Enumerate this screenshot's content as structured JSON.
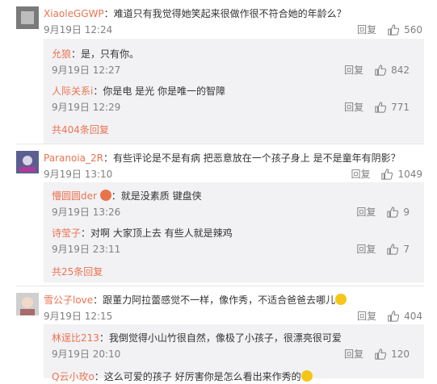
{
  "comments": [
    {
      "user": "XiaoleGGWP",
      "text": "：难道只有我觉得她笑起来很做作很不符合她的年龄么？",
      "time": "9月19日 12:24",
      "reply": "回复",
      "likes": "560",
      "replies": [
        {
          "user": "允狼",
          "text": "：是，只有你。",
          "time": "9月19日 12:27",
          "reply": "回复",
          "likes": "842"
        },
        {
          "user": "人际关系i",
          "text": "：你是电 是光 你是唯一的智障",
          "time": "9月19日 12:29",
          "reply": "回复",
          "likes": "771"
        }
      ],
      "more": "共404条回复"
    },
    {
      "user": "Paranoia_2R",
      "text": "：有些评论是不是有病 把恶意放在一个孩子身上 是不是童年有阴影？",
      "time": "9月19日 13:10",
      "reply": "回复",
      "likes": "1049",
      "replies": [
        {
          "user": "懵圆圆der",
          "text": "：就是没素质 键盘侠",
          "time": "9月19日 13:26",
          "reply": "回复",
          "likes": "9"
        },
        {
          "user": "诗莹子",
          "text": "：对啊 大家顶上去 有些人就是辣鸡",
          "time": "9月19日 23:11",
          "reply": "回复",
          "likes": "7"
        }
      ],
      "more": "共25条回复"
    },
    {
      "user": "雪公子love",
      "text": "：跟董力阿拉蕾感觉不一样，像作秀，不适合爸爸去哪儿",
      "time": "9月19日 12:15",
      "reply": "回复",
      "likes": "404",
      "replies": [
        {
          "user": "林逞比213",
          "text": "：我倒觉得小山竹很自然，像极了小孩子，很漂亮很可爱",
          "time": "9月19日 20:10",
          "reply": "回复",
          "likes": "120"
        },
        {
          "user": "Q云小玫o",
          "text": "：这么可爱的孩子 好厉害你是怎么看出来作秀的",
          "time": "",
          "reply": "",
          "likes": ""
        }
      ]
    }
  ],
  "colors": {
    "username": "#eb7350",
    "meta": "#808080",
    "reply_bg": "#f2f2f5"
  },
  "icons": {
    "like": "thumbs-up-icon",
    "emoji": "grinning-face-emoji"
  }
}
